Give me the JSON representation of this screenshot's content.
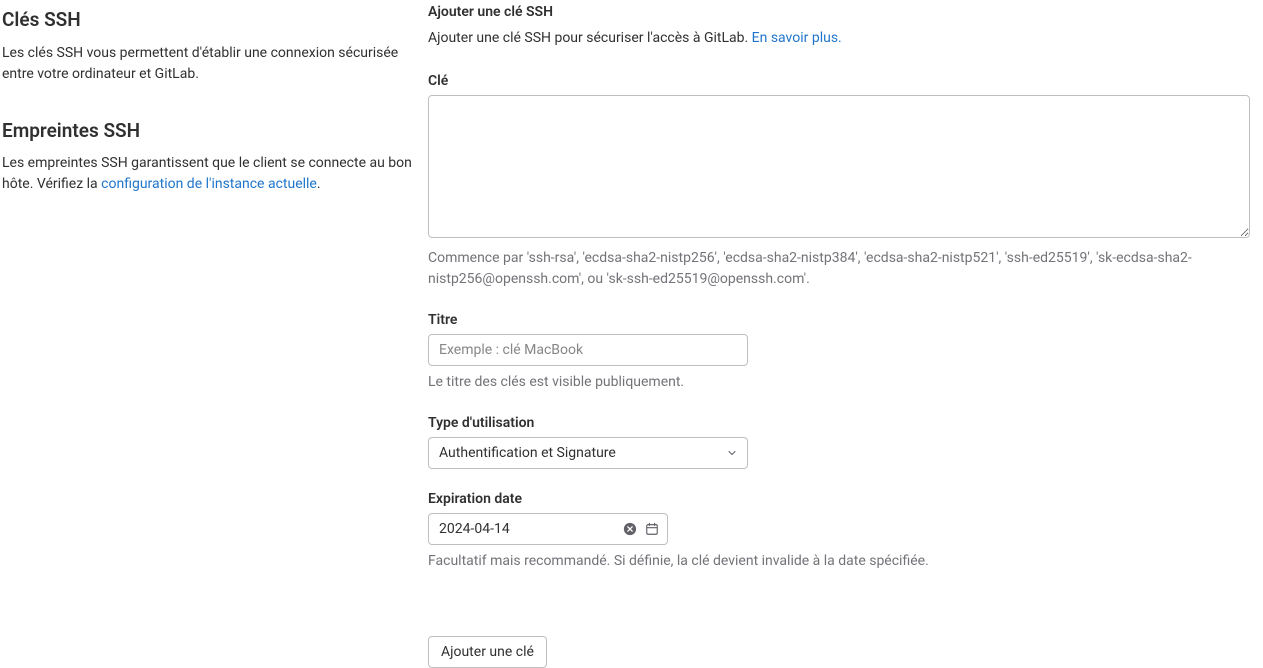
{
  "left": {
    "ssh_keys": {
      "title": "Clés SSH",
      "description": "Les clés SSH vous permettent d'établir une connexion sécurisée entre votre ordinateur et GitLab."
    },
    "ssh_fingerprints": {
      "title": "Empreintes SSH",
      "description_prefix": "Les empreintes SSH garantissent que le client se connecte au bon hôte. Vérifiez la ",
      "link_text": "configuration de l'instance actuelle",
      "description_suffix": "."
    }
  },
  "form": {
    "title": "Ajouter une clé SSH",
    "intro_prefix": "Ajouter une clé SSH pour sécuriser l'accès à GitLab. ",
    "intro_link": "En savoir plus.",
    "key": {
      "label": "Clé",
      "help": "Commence par 'ssh-rsa', 'ecdsa-sha2-nistp256', 'ecdsa-sha2-nistp384', 'ecdsa-sha2-nistp521', 'ssh-ed25519', 'sk-ecdsa-sha2-nistp256@openssh.com', ou 'sk-ssh-ed25519@openssh.com'."
    },
    "title_field": {
      "label": "Titre",
      "placeholder": "Exemple : clé MacBook",
      "help": "Le titre des clés est visible publiquement."
    },
    "usage_type": {
      "label": "Type d'utilisation",
      "selected": "Authentification et Signature"
    },
    "expiration": {
      "label": "Expiration date",
      "value": "2024-04-14",
      "help": "Facultatif mais recommandé. Si définie, la clé devient invalide à la date spécifiée."
    },
    "submit_label": "Ajouter une clé"
  }
}
